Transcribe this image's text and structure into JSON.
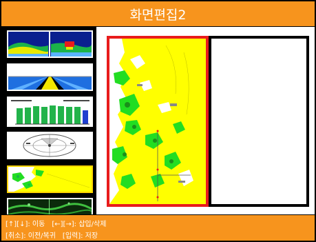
{
  "header": {
    "title": "화면편집2"
  },
  "sidebar": {
    "thumbnails": [
      {
        "name": "sonar-echogram",
        "selected": false
      },
      {
        "name": "3d-highway",
        "selected": false
      },
      {
        "name": "bar-chart",
        "selected": false
      },
      {
        "name": "compass-rose",
        "selected": false
      },
      {
        "name": "nautical-chart",
        "selected": true
      },
      {
        "name": "green-radar",
        "selected": false
      }
    ]
  },
  "canvas": {
    "left_pane_content": "nautical-chart",
    "right_pane_content": "empty"
  },
  "footer": {
    "line1_part1": "[↑][↓]: 이동",
    "line1_part2": "[←][→]: 삽입/삭제",
    "line2_part1": "[취소]: 이전/복귀",
    "line2_part2": "[입력]: 저장"
  },
  "colors": {
    "accent": "#f7941d",
    "selected_border": "#e81c1c",
    "chart_yellow": "#ffff00",
    "chart_green": "#22dd22"
  }
}
